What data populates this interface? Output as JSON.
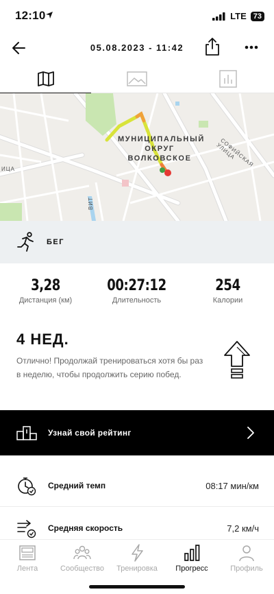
{
  "status_bar": {
    "time": "12:10",
    "network": "LTE",
    "battery": "73"
  },
  "header": {
    "title": "05.08.2023 - 11:42"
  },
  "tabs": [
    {
      "name": "map",
      "icon": "map-icon",
      "active": true
    },
    {
      "name": "photos",
      "icon": "image-icon",
      "active": false
    },
    {
      "name": "charts",
      "icon": "bar-chart-icon",
      "active": false
    }
  ],
  "map": {
    "district_label_line1": "МУНИЦИПАЛЬНЫЙ",
    "district_label_line2": "ОКРУГ",
    "district_label_line3": "ВОЛКОВСКОЕ",
    "street_sofia": "СОФИЙСКАЯ УЛИЦА",
    "street_left": "ИЦА",
    "street_vit": "ВИТ"
  },
  "activity": {
    "label": "БЕГ",
    "icon": "running-icon"
  },
  "stats": [
    {
      "value": "3,28",
      "label": "Дистанция (км)"
    },
    {
      "value": "00:27:12",
      "label": "Длительность"
    },
    {
      "value": "254",
      "label": "Калории"
    }
  ],
  "streak": {
    "title": "4 НЕД.",
    "text": "Отлично! Продолжай тренироваться хотя бы раз в неделю, чтобы продолжить серию побед."
  },
  "rating": {
    "label": "Узнай свой рейтинг"
  },
  "metrics": [
    {
      "label": "Средний темп",
      "value": "08:17 мин/км",
      "icon": "pace-stopwatch-icon"
    },
    {
      "label": "Средняя скорость",
      "value": "7,2 км/ч",
      "icon": "speed-icon"
    }
  ],
  "bottom_nav": [
    {
      "label": "Лента",
      "icon": "feed-icon",
      "active": false
    },
    {
      "label": "Сообщество",
      "icon": "community-icon",
      "active": false
    },
    {
      "label": "Тренировка",
      "icon": "lightning-icon",
      "active": false
    },
    {
      "label": "Прогресс",
      "icon": "progress-bars-icon",
      "active": true
    },
    {
      "label": "Профиль",
      "icon": "profile-icon",
      "active": false
    }
  ],
  "colors": {
    "accent_black": "#000000",
    "map_bg": "#f0eeea",
    "park_green": "#c9e6b1",
    "route_yellow": "#d8e33a",
    "route_red": "#e53935",
    "water_blue": "#a9d4ef",
    "activity_bg": "#edf0f2",
    "inactive_gray": "#a8a8a8"
  }
}
